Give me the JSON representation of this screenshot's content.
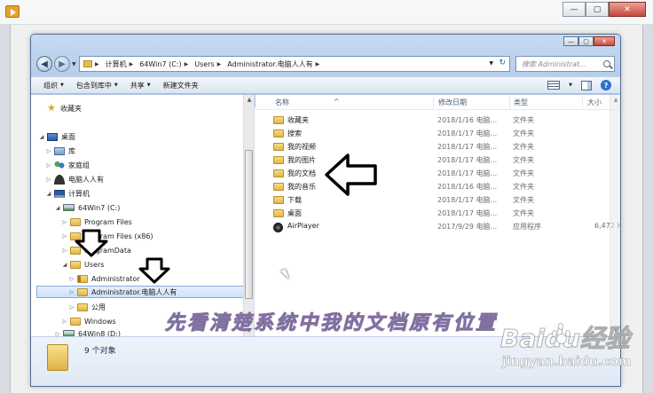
{
  "host": {
    "close_label": "✕",
    "min_label": "—",
    "max_label": "▢"
  },
  "window": {
    "min_label": "—",
    "max_label": "▢",
    "close_label": "✕"
  },
  "address": {
    "crumbs": [
      "计算机",
      "64Win7 (C:)",
      "Users",
      "Administrator.电脑人人有"
    ]
  },
  "search": {
    "placeholder": "搜索 Administrat..."
  },
  "toolbar": {
    "organize": "组织",
    "include_in_library": "包含到库中",
    "share": "共享",
    "new_folder": "新建文件夹"
  },
  "nav": {
    "favorites": "收藏夹",
    "desktop": "桌面",
    "libraries": "库",
    "homegroup": "家庭组",
    "user": "电脑人人有",
    "computer": "计算机",
    "drive_c": "64Win7 (C:)",
    "program_files": "Program Files",
    "program_files_x86": "Program Files (x86)",
    "program_data": "ProgramData",
    "users": "Users",
    "administrator": "Administrator",
    "administrator_user": "Administrator.电脑人人有",
    "public": "公用",
    "windows": "Windows",
    "drive_d": "64Win8 (D:)"
  },
  "columns": {
    "name": "名称",
    "date": "修改日期",
    "type": "类型",
    "size": "大小"
  },
  "files": [
    {
      "name": "收藏夹",
      "date": "2018/1/16 电脑...",
      "type": "文件夹",
      "size": ""
    },
    {
      "name": "搜索",
      "date": "2018/1/17 电脑...",
      "type": "文件夹",
      "size": ""
    },
    {
      "name": "我的视频",
      "date": "2018/1/17 电脑...",
      "type": "文件夹",
      "size": ""
    },
    {
      "name": "我的图片",
      "date": "2018/1/17 电脑...",
      "type": "文件夹",
      "size": ""
    },
    {
      "name": "我的文档",
      "date": "2018/1/17 电脑...",
      "type": "文件夹",
      "size": ""
    },
    {
      "name": "我的音乐",
      "date": "2018/1/16 电脑...",
      "type": "文件夹",
      "size": ""
    },
    {
      "name": "下载",
      "date": "2018/1/17 电脑...",
      "type": "文件夹",
      "size": ""
    },
    {
      "name": "桌面",
      "date": "2018/1/17 电脑...",
      "type": "文件夹",
      "size": ""
    },
    {
      "name": "AirPlayer",
      "date": "2017/9/29 电脑...",
      "type": "应用程序",
      "size": "6,472 K"
    }
  ],
  "details": {
    "count": "9 个对象"
  },
  "caption": "先看清楚系统中我的文档原有位置",
  "watermark": {
    "brand": "Baidu经验",
    "sub": "jingyan.baidu.com"
  }
}
